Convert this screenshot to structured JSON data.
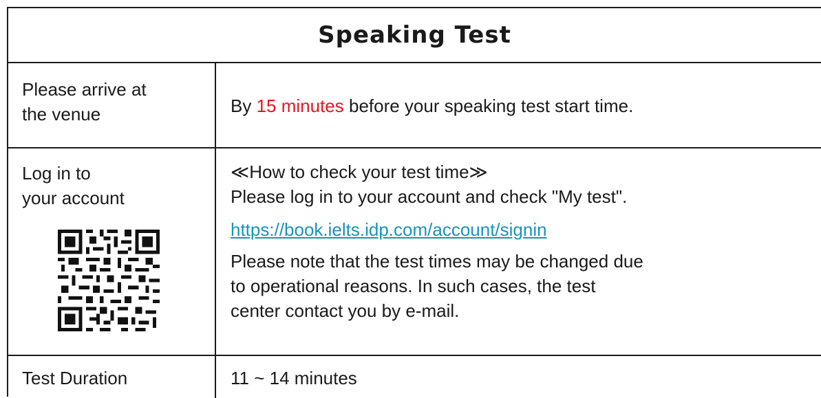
{
  "title": "Speaking Test",
  "rows": {
    "arrive": {
      "label_line1": "Please arrive at",
      "label_line2": "the venue",
      "content_prefix": "By ",
      "content_highlight": "15 minutes",
      "content_suffix": " before your speaking test start time."
    },
    "login": {
      "label_line1": "Log in to",
      "label_line2": "your account",
      "heading": "≪How to check your test time≫",
      "instruction": "Please log in to your account and check \"My test\".",
      "url": "https://book.ielts.idp.com/account/signin",
      "note_line1": "Please note that the test times may be changed due",
      "note_line2": "to operational reasons. In such cases, the test",
      "note_line3": "center contact you by e-mail."
    },
    "duration": {
      "label": "Test Duration",
      "value": "11 ~ 14 minutes"
    }
  },
  "colors": {
    "highlight": "#e8141c",
    "link": "#1a93b8",
    "border": "#1a1a1a"
  }
}
